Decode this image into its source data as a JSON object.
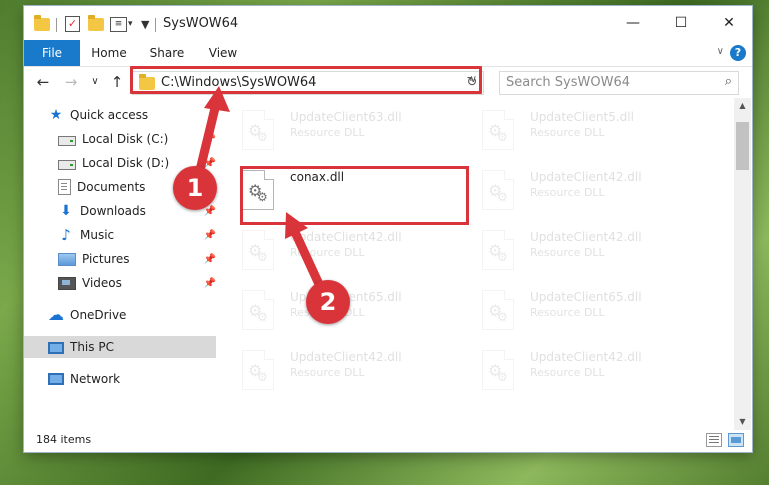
{
  "window": {
    "title": "SysWOW64",
    "minimize_glyph": "—",
    "maximize_glyph": "☐",
    "close_glyph": "✕"
  },
  "ribbon": {
    "tabs": [
      "File",
      "Home",
      "Share",
      "View"
    ],
    "help_glyph": "?",
    "collapse_glyph": "∨"
  },
  "navbar": {
    "back_glyph": "←",
    "forward_glyph": "→",
    "recent_glyph": "∨",
    "up_glyph": "↑",
    "address_path": "C:\\Windows\\SysWOW64",
    "address_dropdown_glyph": "∨",
    "refresh_glyph": "↻",
    "search_placeholder": "Search SysWOW64",
    "search_glyph": "⌕"
  },
  "nav_pane": {
    "items": [
      {
        "label": "Quick access",
        "icon": "star-icon"
      },
      {
        "label": "Local Disk (C:)",
        "icon": "disk-icon",
        "pinned": true
      },
      {
        "label": "Local Disk (D:)",
        "icon": "disk-icon",
        "pinned": true
      },
      {
        "label": "Documents",
        "icon": "documents-icon",
        "pinned": true
      },
      {
        "label": "Downloads",
        "icon": "downloads-icon",
        "pinned": true
      },
      {
        "label": "Music",
        "icon": "music-icon",
        "pinned": true
      },
      {
        "label": "Pictures",
        "icon": "pictures-icon",
        "pinned": true
      },
      {
        "label": "Videos",
        "icon": "videos-icon",
        "pinned": true
      },
      {
        "label": "OneDrive",
        "icon": "cloud-icon"
      },
      {
        "label": "This PC",
        "icon": "computer-icon",
        "selected": true
      },
      {
        "label": "Network",
        "icon": "network-icon"
      }
    ],
    "pin_glyph": "📌"
  },
  "files": [
    {
      "name": "UpdateClient63.dll",
      "type": "Resource DLL",
      "faded": true
    },
    {
      "name": "UpdateClient5.dll",
      "type": "Resource DLL",
      "faded": true
    },
    {
      "name": "conax.dll",
      "type": "",
      "faded": false,
      "highlighted": true
    },
    {
      "name": "UpdateClient42.dll",
      "type": "Resource DLL",
      "faded": true
    },
    {
      "name": "UpdateClient42.dll",
      "type": "Resource DLL",
      "faded": true
    },
    {
      "name": "UpdateClient42.dll",
      "type": "Resource DLL",
      "faded": true
    },
    {
      "name": "UpdateClient65.dll",
      "type": "Resource DLL",
      "faded": true
    },
    {
      "name": "UpdateClient65.dll",
      "type": "Resource DLL",
      "faded": true
    },
    {
      "name": "UpdateClient42.dll",
      "type": "Resource DLL",
      "faded": true
    },
    {
      "name": "UpdateClient42.dll",
      "type": "Resource DLL",
      "faded": true
    }
  ],
  "annotations": {
    "step1": "1",
    "step2": "2",
    "accent_color": "#d9343a"
  },
  "status": {
    "item_count": "184 items"
  },
  "colors": {
    "file_tab": "#1979ca",
    "selection": "#d9d9d9",
    "highlight_red": "#d9343a"
  }
}
